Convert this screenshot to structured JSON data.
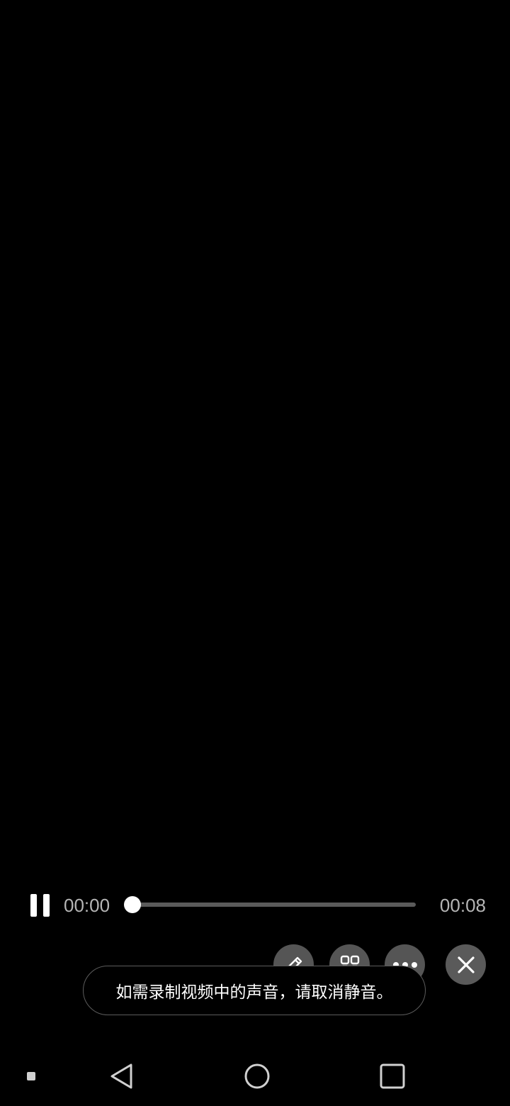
{
  "player": {
    "current_time": "00:00",
    "total_time": "00:08",
    "progress": 0.0
  },
  "actions": {
    "icons": [
      "pencil-icon",
      "grid-icon",
      "more-icon",
      "close-icon"
    ]
  },
  "toast": {
    "message": "如需录制视频中的声音，请取消静音。"
  },
  "navbar": {
    "icons": [
      "menu-dot-icon",
      "back-icon",
      "home-icon",
      "recents-icon"
    ]
  },
  "colors": {
    "background": "#000000",
    "text_primary": "#ffffff",
    "text_secondary": "#b5b5b5",
    "button_bg": "#5a5a5a"
  }
}
